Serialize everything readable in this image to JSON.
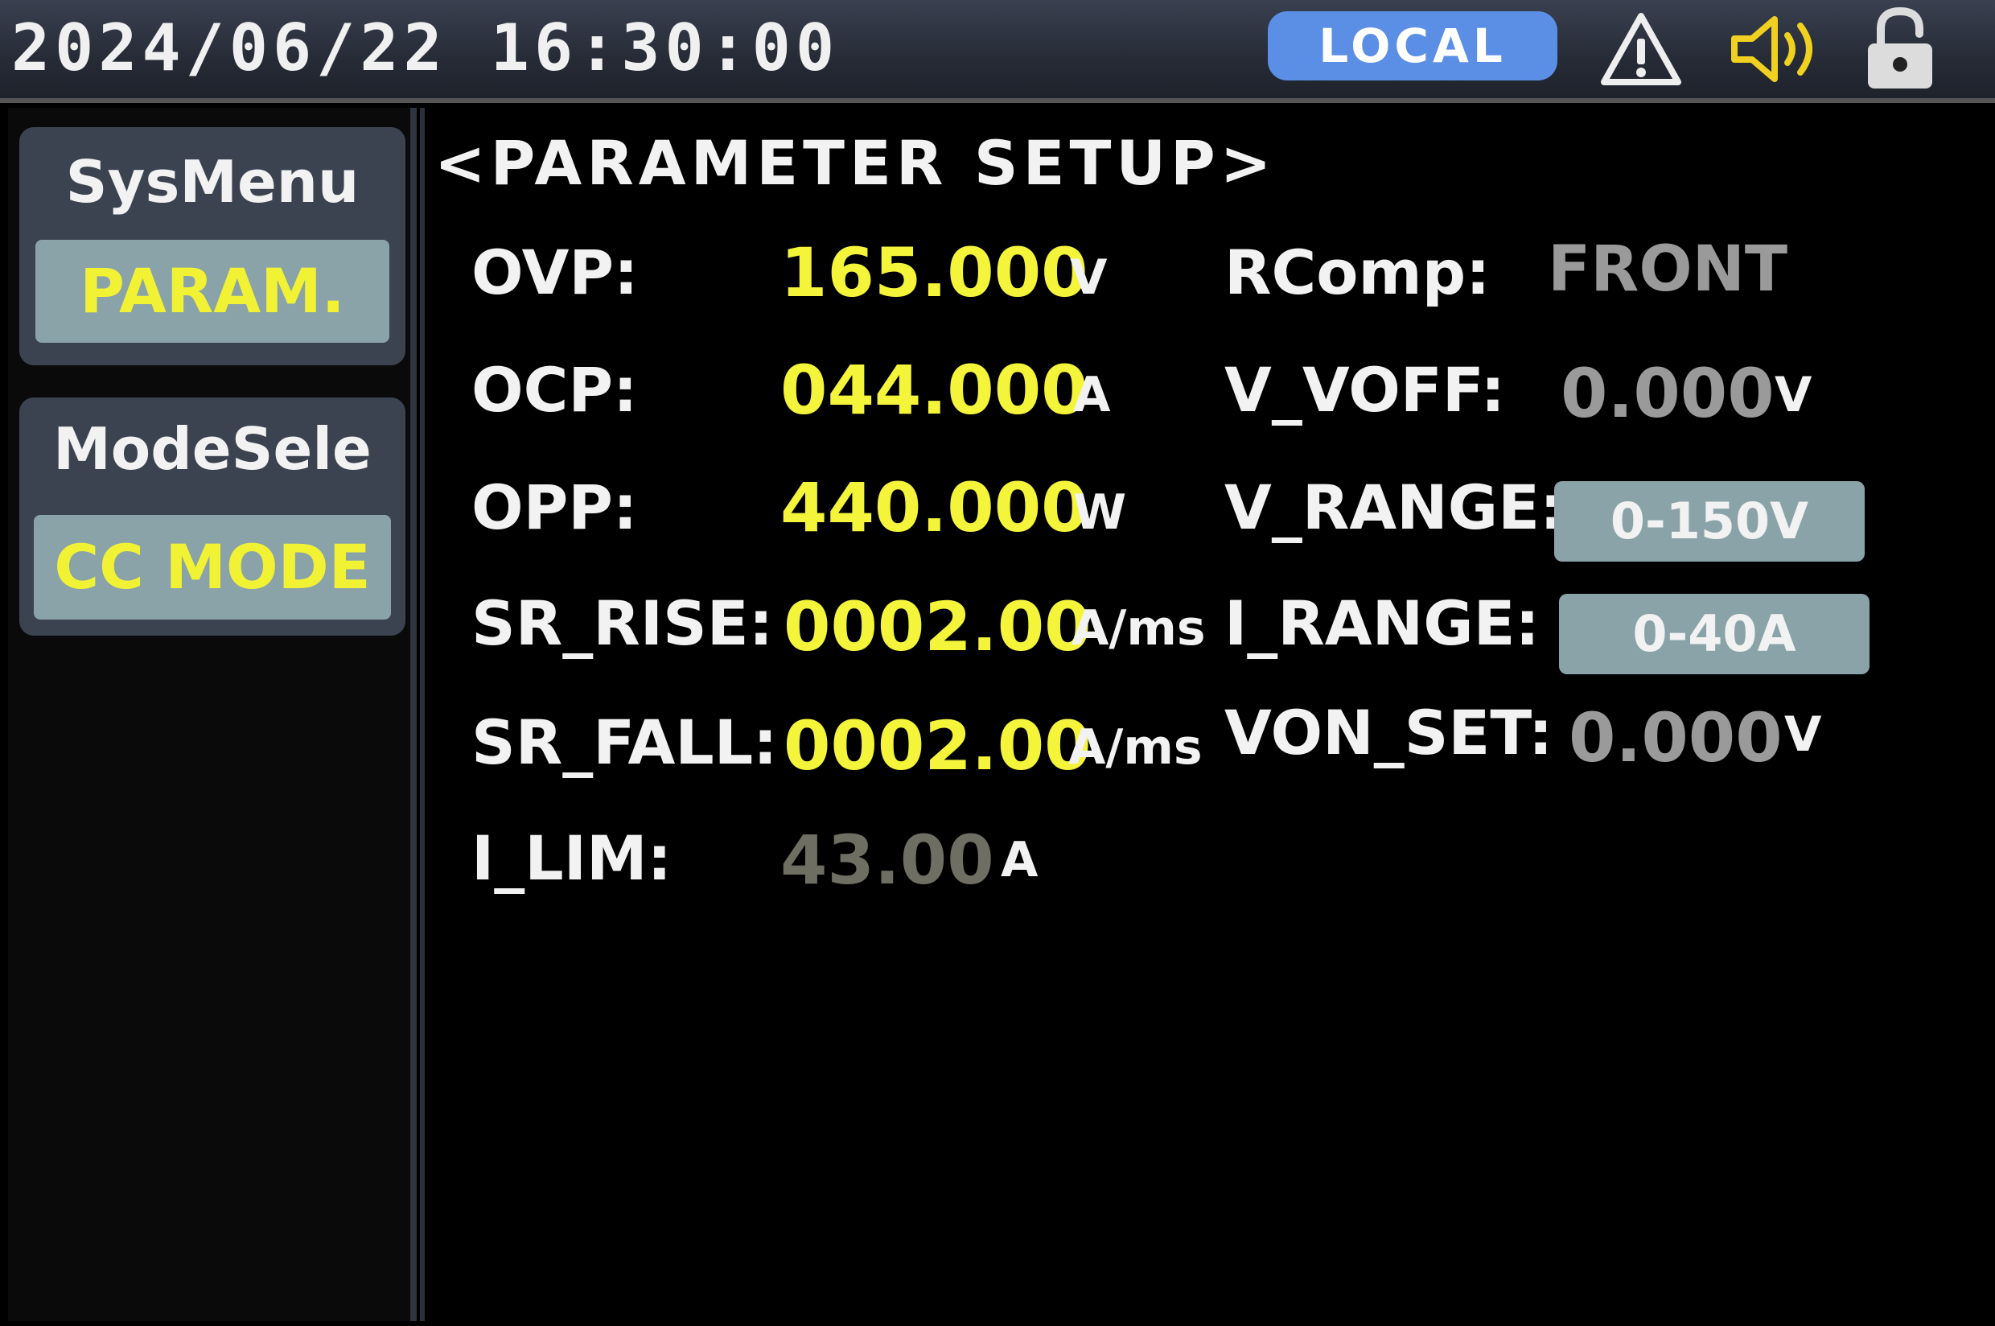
{
  "status_bar": {
    "datetime": "2024/06/22 16:30:00",
    "mode_badge": "LOCAL",
    "icons": [
      "warning-icon",
      "speaker-icon",
      "unlock-icon"
    ],
    "colors": {
      "badge": "#5b8fe6",
      "speaker": "#f0d020"
    }
  },
  "sidebar": {
    "sys_menu": {
      "title": "SysMenu",
      "selected": "PARAM."
    },
    "mode_select": {
      "title": "ModeSele",
      "selected": "CC MODE"
    }
  },
  "main": {
    "title": "<PARAMETER SETUP>",
    "left_params": [
      {
        "label": "OVP:",
        "value": "165.000",
        "unit": "V"
      },
      {
        "label": "OCP:",
        "value": "044.000",
        "unit": "A"
      },
      {
        "label": "OPP:",
        "value": "440.000",
        "unit": "W"
      },
      {
        "label": "SR_RISE:",
        "value": "0002.00",
        "unit": "A/ms"
      },
      {
        "label": "SR_FALL:",
        "value": "0002.00",
        "unit": "A/ms"
      },
      {
        "label": "I_LIM:",
        "value": "43.00",
        "unit": "A"
      }
    ],
    "right_params": [
      {
        "label": "RComp:",
        "value": "FRONT",
        "unit": ""
      },
      {
        "label": "V_VOFF:",
        "value": "0.000",
        "unit": "V"
      },
      {
        "label": "V_RANGE:",
        "value": "0-150V",
        "unit": ""
      },
      {
        "label": "I_RANGE:",
        "value": "0-40A",
        "unit": ""
      },
      {
        "label": "VON_SET:",
        "value": "0.000",
        "unit": "V"
      }
    ],
    "colors": {
      "editable_value": "#f4f43a",
      "readonly_value": "#9a9a9a",
      "range_button": "#8aa3a8"
    }
  }
}
